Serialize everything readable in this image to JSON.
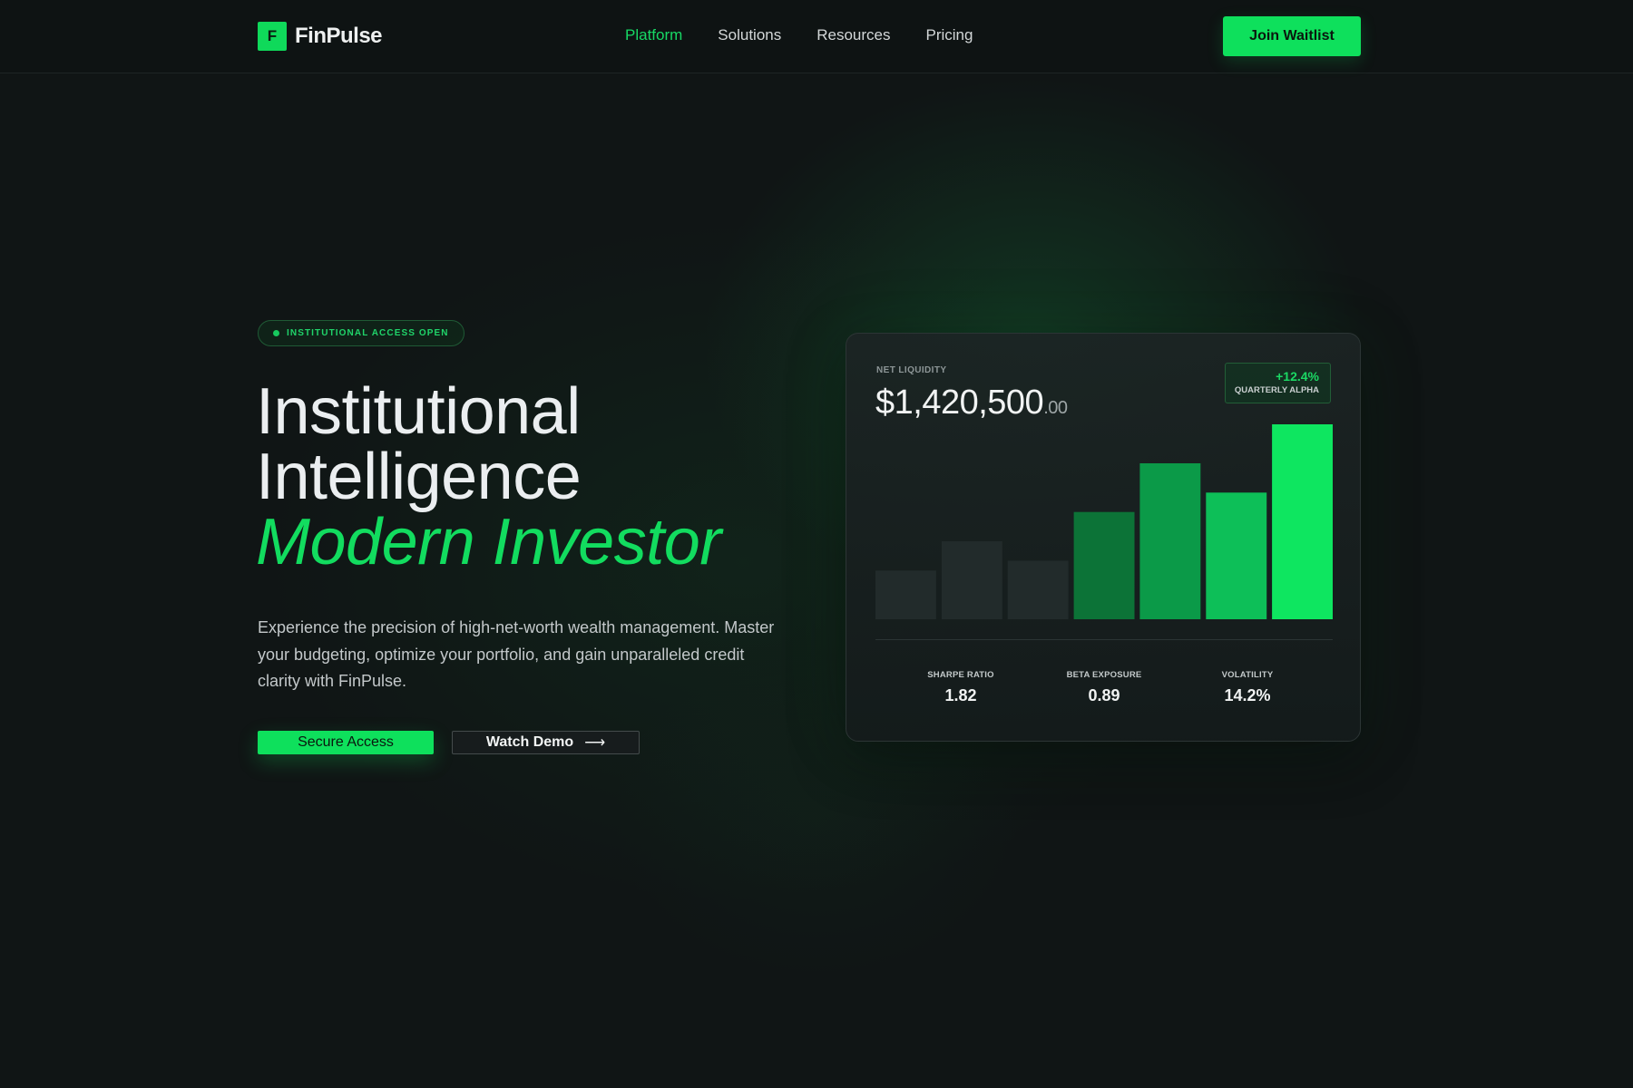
{
  "header": {
    "logo_letter": "F",
    "brand": "FinPulse",
    "nav": [
      {
        "label": "Platform",
        "active": true
      },
      {
        "label": "Solutions",
        "active": false
      },
      {
        "label": "Resources",
        "active": false
      },
      {
        "label": "Pricing",
        "active": false
      }
    ],
    "cta": "Join Waitlist"
  },
  "hero": {
    "badge": "INSTITUTIONAL ACCESS OPEN",
    "title_line1": "Institutional",
    "title_line2": "Intelligence",
    "title_accent": "Modern Investor",
    "description": "Experience the precision of high-net-worth wealth management. Master your budgeting, optimize your portfolio, and gain unparalleled credit clarity with FinPulse.",
    "primary_button": "Secure Access",
    "secondary_button": "Watch Demo",
    "secondary_icon": "arrow-right-icon"
  },
  "card": {
    "label": "NET LIQUIDITY",
    "value_main": "$1,420,500",
    "value_cents": ".00",
    "alpha_value": "+12.4%",
    "alpha_label": "QUARTERLY ALPHA",
    "stats": [
      {
        "label": "SHARPE RATIO",
        "value": "1.82"
      },
      {
        "label": "BETA EXPOSURE",
        "value": "0.89"
      },
      {
        "label": "VOLATILITY",
        "value": "14.2%"
      }
    ]
  },
  "chart_data": {
    "type": "bar",
    "values": [
      25,
      40,
      30,
      55,
      80,
      65,
      100
    ],
    "colors": [
      "#222b2b",
      "#222b2b",
      "#222b2b",
      "#0c7337",
      "#0b9a48",
      "#0dbf58",
      "#0ee660"
    ],
    "ylim": [
      0,
      100
    ],
    "grid": false
  },
  "colors": {
    "accent": "#0ee05c",
    "background": "#101515"
  }
}
